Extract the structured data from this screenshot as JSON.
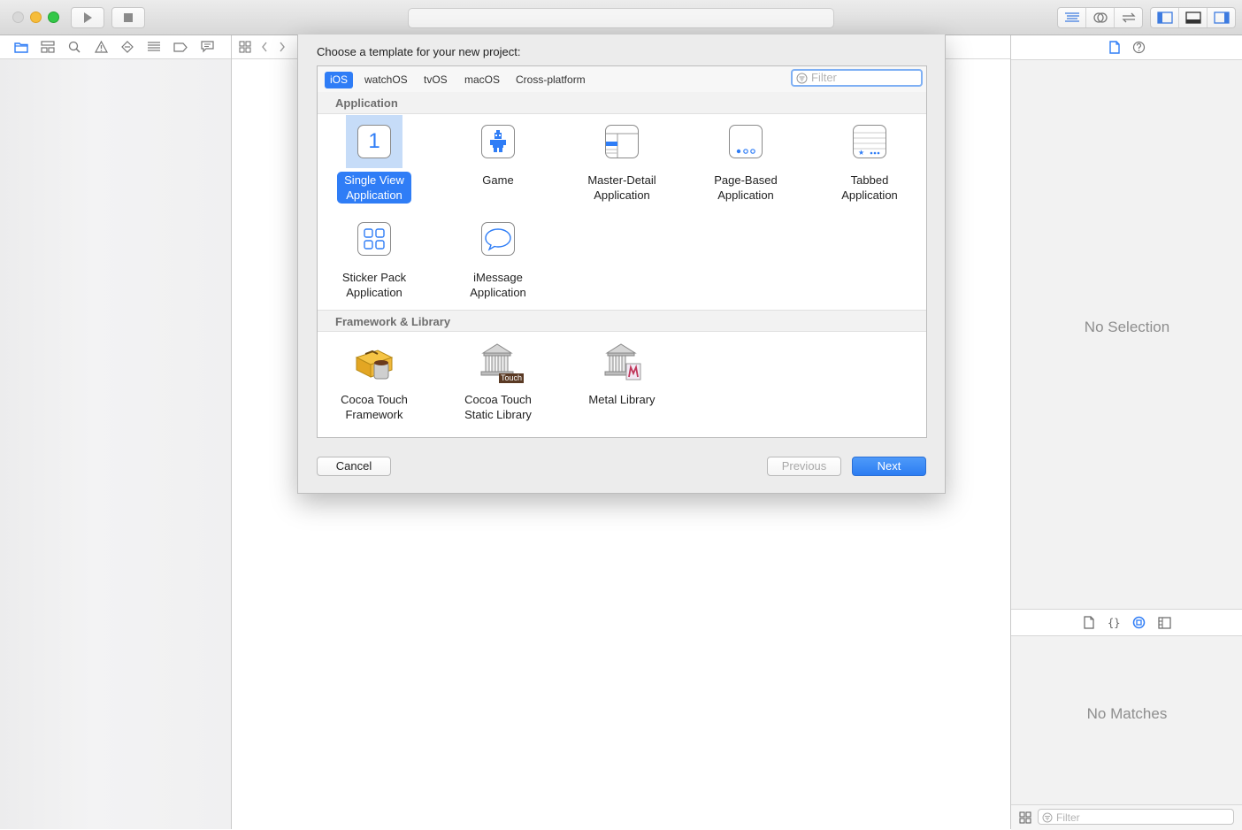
{
  "toolbar": {
    "run_icon": "play-icon",
    "stop_icon": "stop-icon"
  },
  "navigator": {
    "icons": [
      "folder-icon",
      "hierarchy-icon",
      "search-icon",
      "warning-icon",
      "test-diamond-icon",
      "list-icon",
      "tag-icon",
      "comment-icon"
    ]
  },
  "dialog": {
    "title": "Choose a template for your new project:",
    "tabs": [
      {
        "label": "iOS",
        "active": true
      },
      {
        "label": "watchOS",
        "active": false
      },
      {
        "label": "tvOS",
        "active": false
      },
      {
        "label": "macOS",
        "active": false
      },
      {
        "label": "Cross-platform",
        "active": false
      }
    ],
    "filter_placeholder": "Filter",
    "sections": {
      "application": "Application",
      "framework": "Framework & Library"
    },
    "templates": {
      "single_view": "Single View\nApplication",
      "game": "Game",
      "master_detail": "Master-Detail\nApplication",
      "page_based": "Page-Based\nApplication",
      "tabbed": "Tabbed\nApplication",
      "sticker_pack": "Sticker Pack\nApplication",
      "imessage": "iMessage\nApplication",
      "cocoa_framework": "Cocoa Touch\nFramework",
      "cocoa_static": "Cocoa Touch\nStatic Library",
      "metal": "Metal Library"
    },
    "single_view_icon_text": "1",
    "touch_badge": "Touch",
    "buttons": {
      "cancel": "Cancel",
      "previous": "Previous",
      "next": "Next"
    }
  },
  "inspector": {
    "no_selection": "No Selection",
    "no_matches": "No Matches",
    "library_filter_placeholder": "Filter"
  },
  "colors": {
    "accent": "#2f7df6",
    "selection_tint": "#c6dcf8"
  }
}
